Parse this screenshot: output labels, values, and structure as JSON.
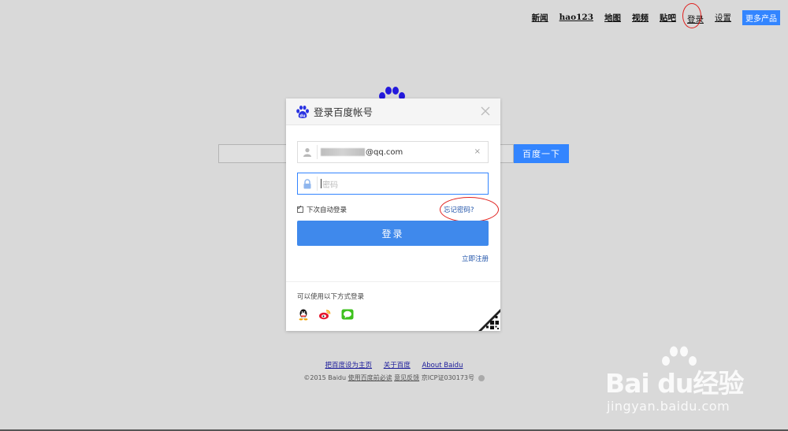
{
  "topnav": {
    "items": [
      "新闻",
      "hao123",
      "地图",
      "视频",
      "贴吧"
    ],
    "login": "登录",
    "settings": "设置",
    "more": "更多产品"
  },
  "search": {
    "button": "百度一下"
  },
  "modal": {
    "title": "登录百度帐号",
    "username_suffix": "@qq.com",
    "clear": "×",
    "password_placeholder": "密码",
    "remember": "下次自动登录",
    "forgot": "忘记密码?",
    "login_button": "登录",
    "register": "立即注册",
    "other_login": "可以使用以下方式登录"
  },
  "footer": {
    "links": [
      "把百度设为主页",
      "关于百度",
      "About Baidu"
    ],
    "copyright": "©2015 Baidu",
    "must_read": "使用百度前必读",
    "feedback": "意见反馈",
    "icp": "京ICP证030173号"
  },
  "watermark": {
    "main": "Bai du经验",
    "sub": "jingyan.baidu.com"
  },
  "colors": {
    "accent": "#3385ff",
    "login_button": "#3f89ec",
    "annotation_ring": "#e0201e",
    "backdrop": "#d9d9d9"
  },
  "icons": [
    "baidu-paw-icon",
    "user-icon",
    "lock-icon",
    "close-icon",
    "qq-icon",
    "weibo-icon",
    "wechat-icon",
    "qrcode-icon"
  ]
}
